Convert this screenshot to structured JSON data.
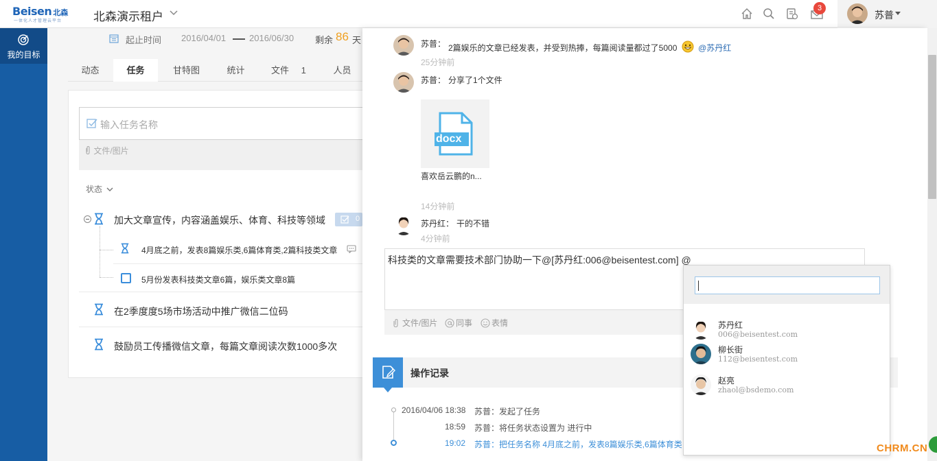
{
  "header": {
    "logo_text": "Beisen",
    "logo_cn": "北森",
    "logo_sub": "一体化人才管理云平台",
    "tenant_name": "北森演示租户",
    "notification_count": "3",
    "user_name": "苏普"
  },
  "sidebar": {
    "items": [
      {
        "label": "我的目标",
        "icon": "target-icon"
      }
    ]
  },
  "task_page": {
    "date_label": "起止时间",
    "date_start": "2016/04/01",
    "date_end": "2016/06/30",
    "remain_label": "剩余",
    "remain_days": "86",
    "remain_unit": "天",
    "tabs": [
      {
        "label": "动态"
      },
      {
        "label": "任务",
        "active": true
      },
      {
        "label": "甘特图"
      },
      {
        "label": "统计"
      },
      {
        "label": "文件",
        "count": "1"
      },
      {
        "label": "人员"
      }
    ],
    "new_task_placeholder": "输入任务名称",
    "attach_label": "文件/图片",
    "status_filter": "状态",
    "tasks": [
      {
        "title": "加大文章宣传，内容涵盖娱乐、体育、科技等领域",
        "badge": "0"
      },
      {
        "title": "4月底之前，发表8篇娱乐类,6篇体育类,2篇科技类文章"
      },
      {
        "title": "5月份发表科技类文章6篇，娱乐类文章8篇"
      },
      {
        "title": "在2季度度5场市场活动中推广微信二位码"
      },
      {
        "title": "鼓励员工传播微信文章，每篇文章阅读次数1000多次"
      }
    ]
  },
  "comments": [
    {
      "author": "苏普：",
      "text": "2篇娱乐的文章已经发表，并受到热捧，每篇阅读量都过了5000",
      "mention": "@苏丹红",
      "time": "25分钟前"
    },
    {
      "author": "苏普：",
      "text": "分享了1个文件",
      "file_ext": "docx",
      "file_name": "喜欢岳云鹏的n...",
      "time": "14分钟前"
    },
    {
      "author": "苏丹红：",
      "text": "干的不错",
      "time": "4分钟前"
    }
  ],
  "reply": {
    "text": "科技类的文章需要技术部门协助一下@[苏丹红:006@beisentest.com]  @",
    "tools": [
      {
        "label": "文件/图片",
        "icon": "paperclip-icon"
      },
      {
        "label": "同事",
        "icon": "at-icon"
      },
      {
        "label": "表情",
        "icon": "smiley-icon"
      }
    ]
  },
  "oplog": {
    "title": "操作记录",
    "entries": [
      {
        "date": "2016/04/06 18:38",
        "text": "苏普：发起了任务"
      },
      {
        "date": "18:59",
        "text": "苏普：将任务状态设置为 进行中"
      },
      {
        "date": "19:02",
        "text": "苏普：把任务名称 4月底之前，发表8篇娱乐类,6篇体育类"
      }
    ]
  },
  "mention_popup": {
    "search_value": "",
    "people": [
      {
        "name": "苏丹红",
        "email": "006@beisentest.com"
      },
      {
        "name": "柳长街",
        "email": "112@beisentest.com"
      },
      {
        "name": "赵亮",
        "email": "zhaol@bsdemo.com"
      }
    ]
  },
  "watermark": "CHRM.CN",
  "colors": {
    "brand_blue": "#175da4",
    "accent_blue": "#3d8fd8",
    "remain_orange": "#f0a020",
    "badge_red": "#e8483c"
  }
}
